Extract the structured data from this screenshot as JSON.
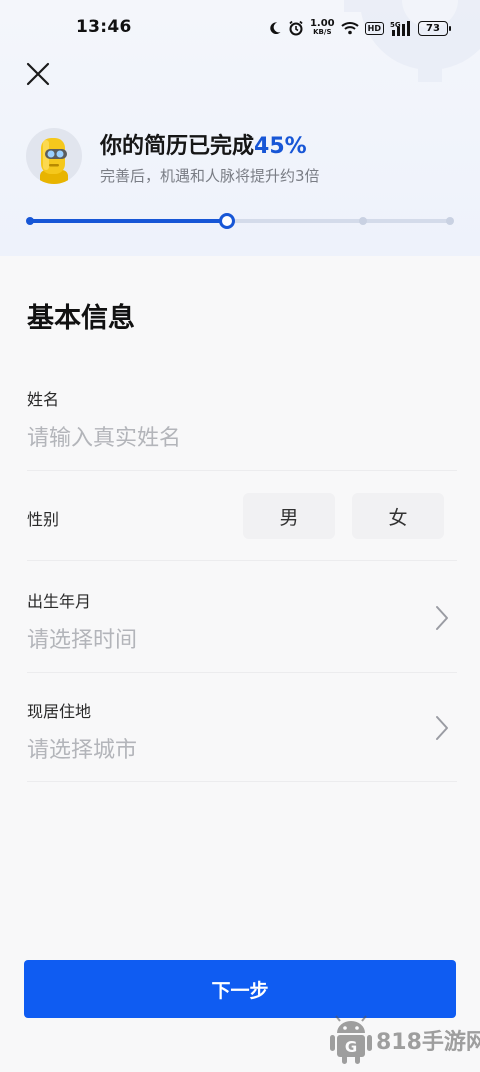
{
  "status_bar": {
    "time": "13:46",
    "net_speed_value": "1.00",
    "net_speed_unit": "KB/S",
    "hd_label": "HD",
    "signal_label": "5G",
    "battery": "73"
  },
  "header": {
    "progress_prefix": "你的简历已完成",
    "progress_percent": "45%",
    "progress_value": 0.47,
    "subtitle": "完善后，机遇和人脉将提升约3倍"
  },
  "form": {
    "section_title": "基本信息",
    "name": {
      "label": "姓名",
      "placeholder": "请输入真实姓名"
    },
    "gender": {
      "label": "性别",
      "options": [
        "男",
        "女"
      ]
    },
    "birth": {
      "label": "出生年月",
      "placeholder": "请选择时间"
    },
    "residence": {
      "label": "现居住地",
      "placeholder": "请选择城市"
    }
  },
  "footer": {
    "next_label": "下一步"
  },
  "watermark": {
    "text": "818手游网"
  },
  "colors": {
    "accent": "#1756d6",
    "button": "#0f5cf2",
    "placeholder": "#b3b5ba"
  },
  "icons": [
    "close-icon",
    "chevron-right-icon",
    "moon-icon",
    "alarm-icon",
    "wifi-icon",
    "signal-icon",
    "battery-icon",
    "android-icon"
  ]
}
